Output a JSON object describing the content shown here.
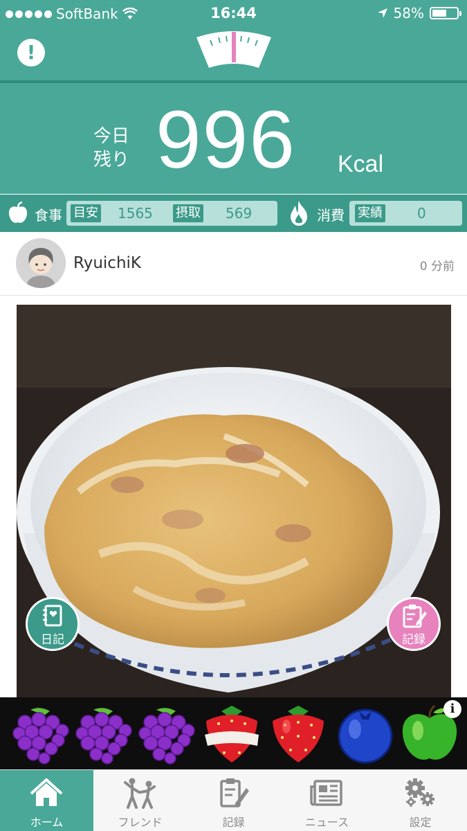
{
  "status_bar": {
    "carrier": "SoftBank",
    "time": "16:44",
    "battery_text": "58%",
    "battery_level": 0.58
  },
  "kcal": {
    "label_line1": "今日",
    "label_line2": "残り",
    "value": "996",
    "unit": "Kcal"
  },
  "summary": {
    "meal_label": "食事",
    "target_tag": "目安",
    "target_value": "1565",
    "intake_tag": "摂取",
    "intake_value": "569",
    "burn_label": "消費",
    "actual_tag": "実績",
    "actual_value": "0"
  },
  "post": {
    "username": "RyuichiK",
    "time_ago": "0 分前"
  },
  "actions": {
    "diary_label": "日記",
    "record_label": "記録"
  },
  "ad": {
    "info_symbol": "i",
    "fruits": [
      "grape",
      "grape",
      "grape",
      "strawberry-bandaged",
      "strawberry",
      "blueberry",
      "green-apple"
    ]
  },
  "tabs": [
    {
      "label": "ホーム",
      "icon": "home-icon",
      "active": true
    },
    {
      "label": "フレンド",
      "icon": "friends-icon",
      "active": false
    },
    {
      "label": "記録",
      "icon": "record-icon",
      "active": false
    },
    {
      "label": "ニュース",
      "icon": "news-icon",
      "active": false
    },
    {
      "label": "設定",
      "icon": "settings-icon",
      "active": false
    }
  ],
  "colors": {
    "primary": "#4aa898",
    "primary_dark": "#3b9a8a",
    "record_pink": "#e782bd"
  }
}
